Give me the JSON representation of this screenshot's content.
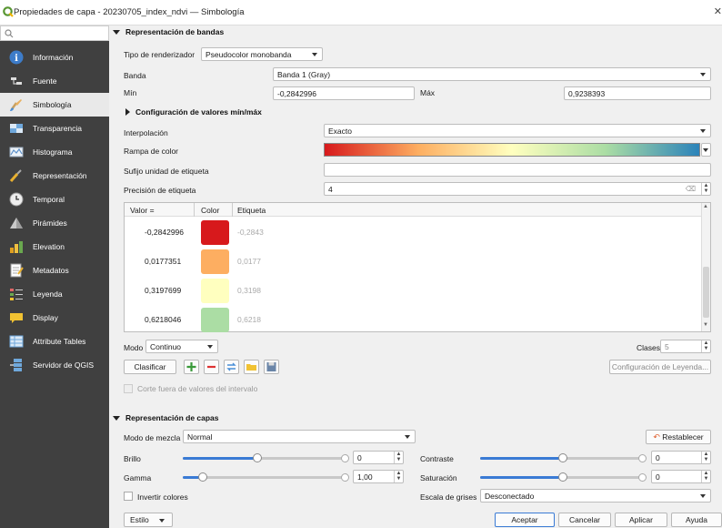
{
  "window": {
    "title": "Propiedades de capa - 20230705_index_ndvi — Simbología",
    "close": "✕"
  },
  "sidebar": {
    "search_placeholder": "",
    "items": [
      {
        "label": "Información"
      },
      {
        "label": "Fuente"
      },
      {
        "label": "Simbología"
      },
      {
        "label": "Transparencia"
      },
      {
        "label": "Histograma"
      },
      {
        "label": "Representación"
      },
      {
        "label": "Temporal"
      },
      {
        "label": "Pirámides"
      },
      {
        "label": "Elevation"
      },
      {
        "label": "Metadatos"
      },
      {
        "label": "Leyenda"
      },
      {
        "label": "Display"
      },
      {
        "label": "Attribute Tables"
      },
      {
        "label": "Servidor de QGIS"
      }
    ],
    "selected": "Simbología"
  },
  "bands": {
    "section_title": "Representación de bandas",
    "renderer_label": "Tipo de renderizador",
    "renderer_value": "Pseudocolor monobanda",
    "band_label": "Banda",
    "band_value": "Banda 1 (Gray)",
    "min_label": "Mín",
    "min_value": "-0,2842996",
    "max_label": "Máx",
    "max_value": "0,9238393",
    "minmax_section": "Configuración de valores mín/máx",
    "interp_label": "Interpolación",
    "interp_value": "Exacto",
    "ramp_label": "Rampa de color",
    "ramp_colors": [
      "#d7191c",
      "#fdae61",
      "#ffffbf",
      "#abdda4",
      "#2b83ba"
    ],
    "suffix_label": "Sufijo unidad de etiqueta",
    "suffix_value": "",
    "precision_label": "Precisión de etiqueta",
    "precision_value": "4",
    "table": {
      "headers": [
        "Valor =",
        "Color",
        "Etiqueta"
      ],
      "rows": [
        {
          "value": "-0,2842996",
          "color": "#d7191c",
          "label": "-0,2843"
        },
        {
          "value": "0,0177351",
          "color": "#fdae61",
          "label": "0,0177"
        },
        {
          "value": "0,3197699",
          "color": "#ffffbf",
          "label": "0,3198"
        },
        {
          "value": "0,6218046",
          "color": "#abdda4",
          "label": "0,6218"
        }
      ]
    },
    "mode_label": "Modo",
    "mode_value": "Continuo",
    "classes_label": "Clases",
    "classes_value": "5",
    "classify_button": "Clasificar",
    "legend_config_button": "Configuración de Leyenda...",
    "clip_label": "Corte fuera de valores del intervalo"
  },
  "layer_render": {
    "section_title": "Representación de capas",
    "blend_label": "Modo de mezcla",
    "blend_value": "Normal",
    "reset_button": "Restablecer",
    "brightness_label": "Brillo",
    "brightness_value": "0",
    "brightness_level": 0.45,
    "contrast_label": "Contraste",
    "contrast_value": "0",
    "contrast_level": 0.5,
    "gamma_label": "Gamma",
    "gamma_value": "1,00",
    "gamma_level": 0.1,
    "saturation_label": "Saturación",
    "saturation_value": "0",
    "saturation_level": 0.5,
    "invert_label": "Invertir colores",
    "gray_label": "Escala de grises",
    "gray_value": "Desconectado"
  },
  "footer": {
    "style_button": "Estilo",
    "ok_button": "Aceptar",
    "cancel_button": "Cancelar",
    "apply_button": "Aplicar",
    "help_button": "Ayuda"
  },
  "colors": {
    "sidebar_bg": "#404040",
    "accent": "#3a7bd5"
  }
}
